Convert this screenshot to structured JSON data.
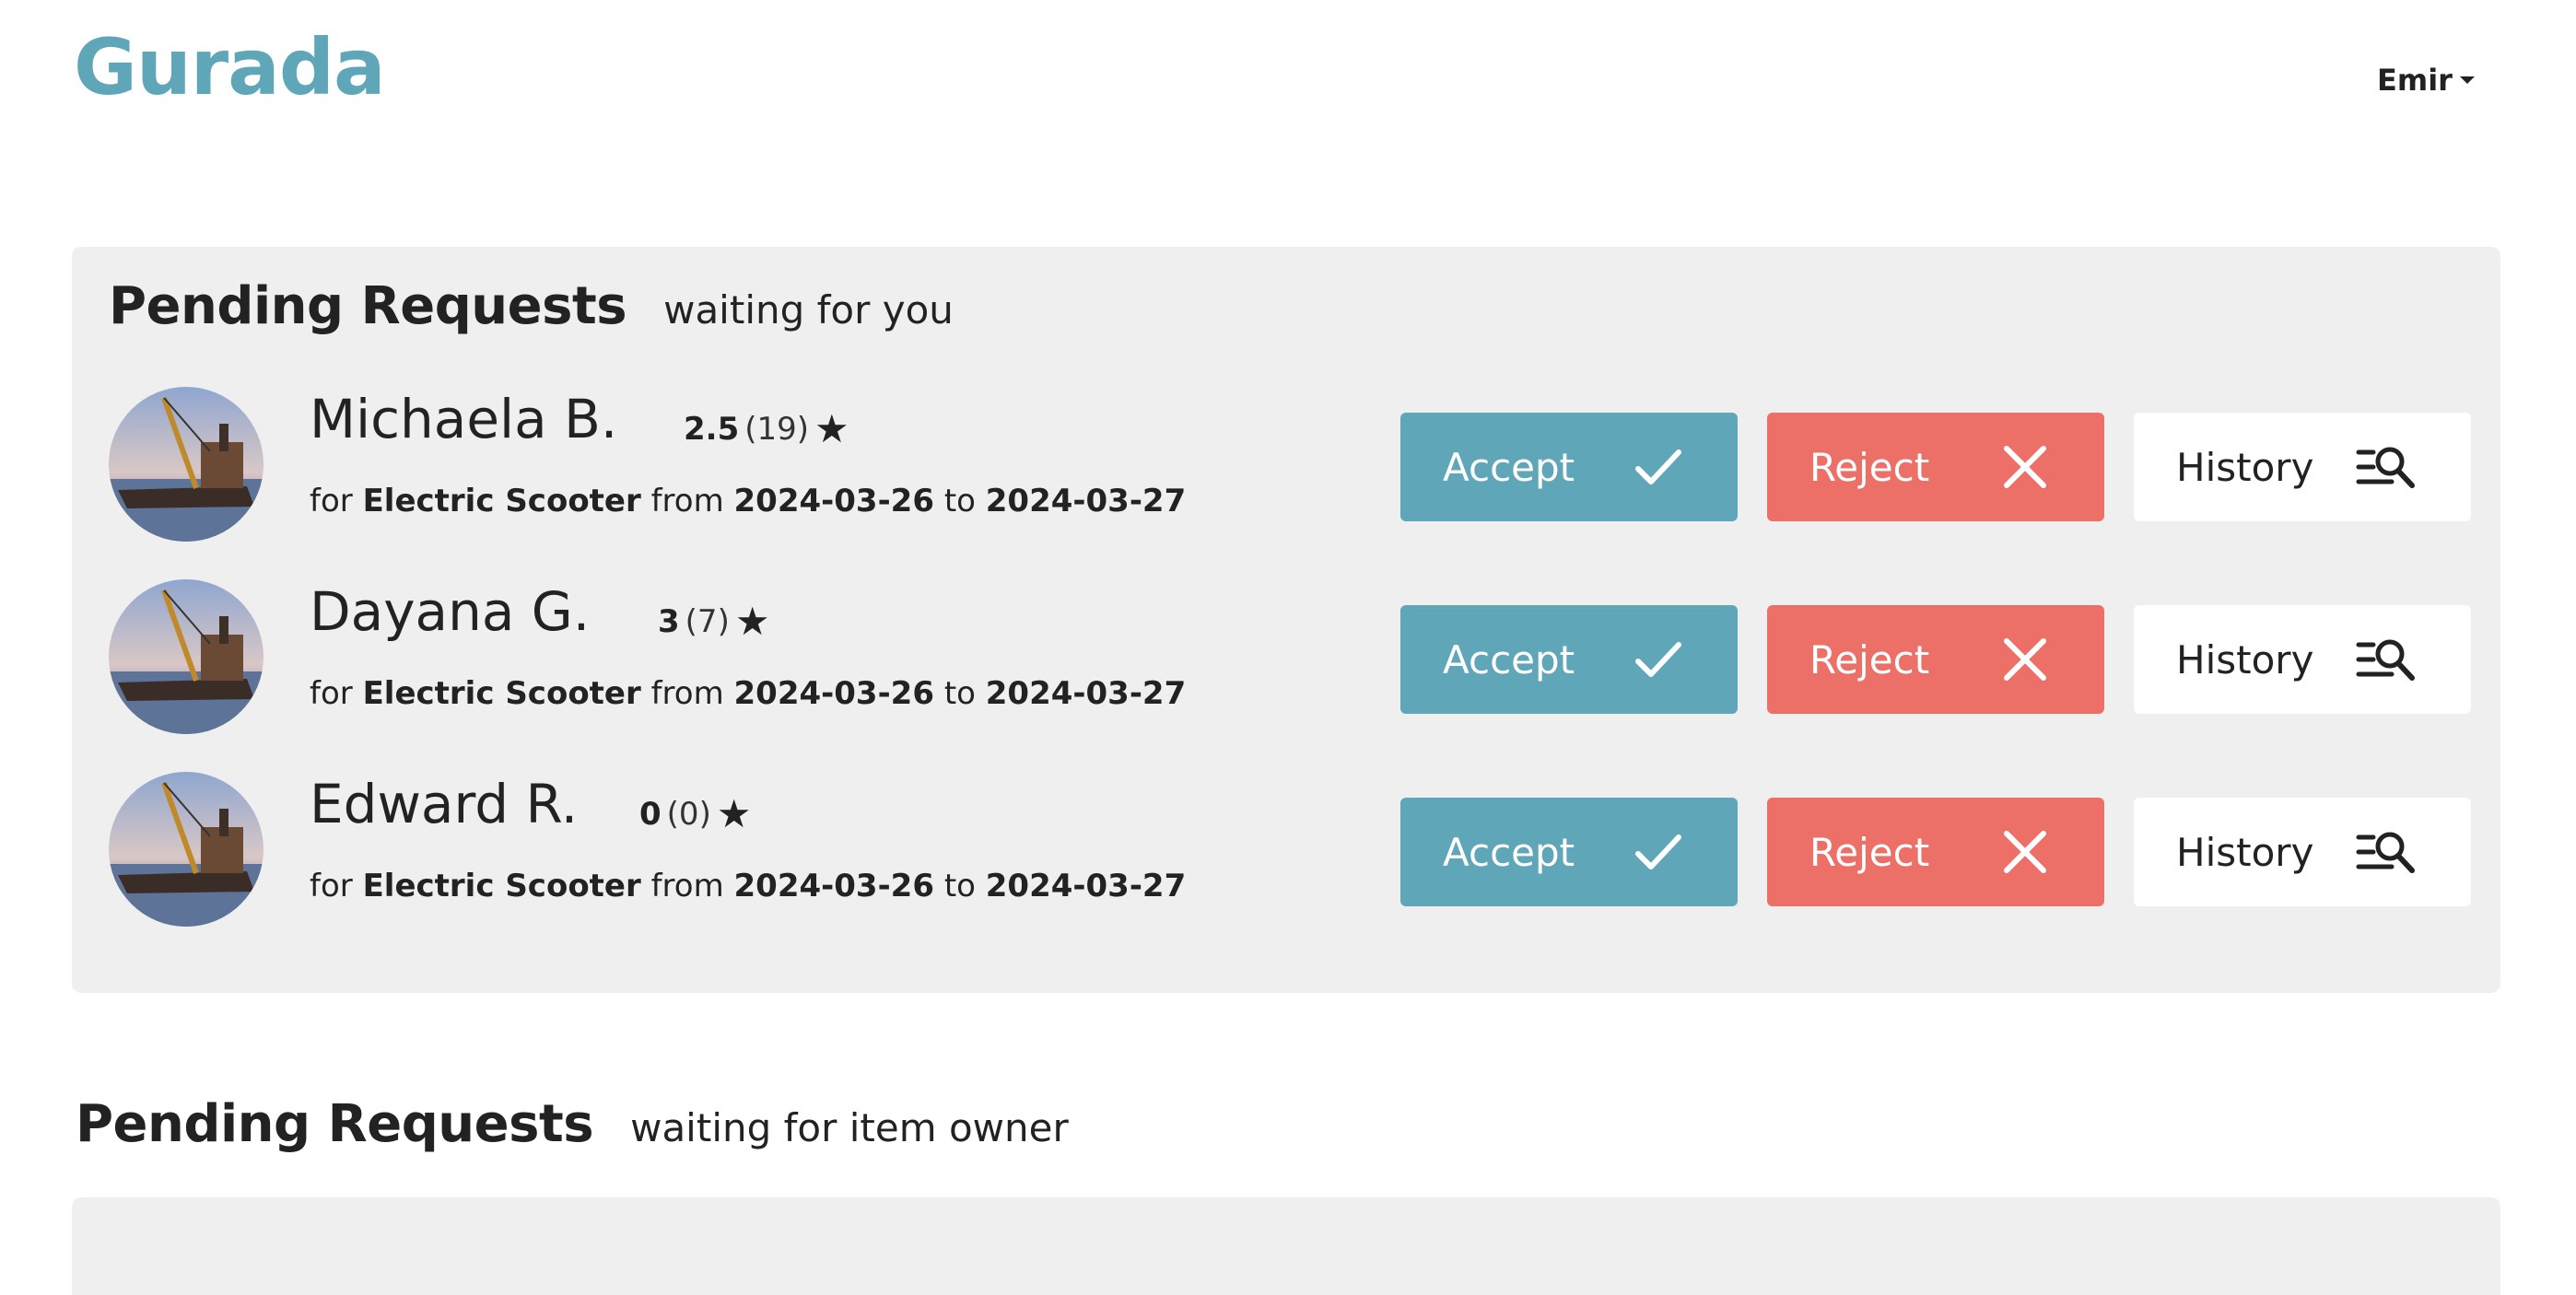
{
  "app": {
    "logo": "Gurada"
  },
  "user_menu": {
    "label": "Emir"
  },
  "colors": {
    "brand": "#5fa6b9",
    "accept": "#5fa6b9",
    "reject": "#ec7067",
    "panel_bg": "#efefef"
  },
  "incoming": {
    "title": "Pending Requests",
    "subtitle": "waiting for you",
    "requests": [
      {
        "name": "Michaela B.",
        "rating": "2.5",
        "rating_count": "(19)",
        "star": "★",
        "for_text": "for",
        "item": "Electric Scooter",
        "from_text": "from",
        "from_date": "2024-03-26",
        "to_text": "to",
        "to_date": "2024-03-27",
        "accept_label": "Accept",
        "reject_label": "Reject",
        "history_label": "History"
      },
      {
        "name": "Dayana G.",
        "rating": "3",
        "rating_count": "(7)",
        "star": "★",
        "for_text": "for",
        "item": "Electric Scooter",
        "from_text": "from",
        "from_date": "2024-03-26",
        "to_text": "to",
        "to_date": "2024-03-27",
        "accept_label": "Accept",
        "reject_label": "Reject",
        "history_label": "History"
      },
      {
        "name": "Edward R.",
        "rating": "0",
        "rating_count": "(0)",
        "star": "★",
        "for_text": "for",
        "item": "Electric Scooter",
        "from_text": "from",
        "from_date": "2024-03-26",
        "to_text": "to",
        "to_date": "2024-03-27",
        "accept_label": "Accept",
        "reject_label": "Reject",
        "history_label": "History"
      }
    ]
  },
  "outgoing": {
    "title": "Pending Requests",
    "subtitle": "waiting for item owner"
  },
  "icons": {
    "accept": "check-icon",
    "reject": "close-icon",
    "history": "list-search-icon",
    "avatar": "harbor-crane-photo",
    "user_menu": "caret-down-icon"
  }
}
